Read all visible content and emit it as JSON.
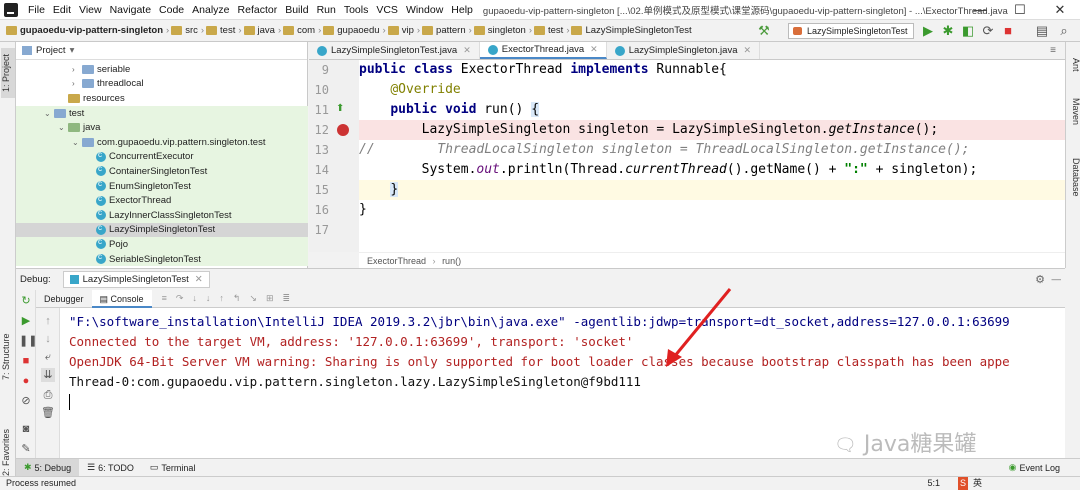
{
  "menu": [
    "File",
    "Edit",
    "View",
    "Navigate",
    "Code",
    "Analyze",
    "Refactor",
    "Build",
    "Run",
    "Tools",
    "VCS",
    "Window",
    "Help"
  ],
  "title": "gupaoedu-vip-pattern-singleton [...\\02.单例模式及原型模式\\课堂源码\\gupaoedu-vip-pattern-singleton] - ...\\ExectorThread.java",
  "breadcrumbs": [
    "gupaoedu-vip-pattern-singleton",
    "src",
    "test",
    "java",
    "com",
    "gupaoedu",
    "vip",
    "pattern",
    "singleton",
    "test",
    "LazySimpleSingletonTest"
  ],
  "run_config": "LazySimpleSingletonTest",
  "project_panel": {
    "header": "Project",
    "rows": [
      {
        "label": "seriable",
        "kind": "folder",
        "depth": 4,
        "arrow": "›"
      },
      {
        "label": "threadlocal",
        "kind": "folder",
        "depth": 4,
        "arrow": "›"
      },
      {
        "label": "resources",
        "kind": "res",
        "depth": 3,
        "arrow": ""
      },
      {
        "label": "test",
        "kind": "folder",
        "depth": 2,
        "arrow": "⌄"
      },
      {
        "label": "java",
        "kind": "src",
        "depth": 3,
        "arrow": "⌄"
      },
      {
        "label": "com.gupaoedu.vip.pattern.singleton.test",
        "kind": "folder",
        "depth": 4,
        "arrow": "⌄"
      },
      {
        "label": "ConcurrentExecutor",
        "kind": "class",
        "depth": 5,
        "arrow": ""
      },
      {
        "label": "ContainerSingletonTest",
        "kind": "class",
        "depth": 5,
        "arrow": ""
      },
      {
        "label": "EnumSingletonTest",
        "kind": "class",
        "depth": 5,
        "arrow": ""
      },
      {
        "label": "ExectorThread",
        "kind": "class",
        "depth": 5,
        "arrow": ""
      },
      {
        "label": "LazyInnerClassSingletonTest",
        "kind": "class",
        "depth": 5,
        "arrow": ""
      },
      {
        "label": "LazySimpleSingletonTest",
        "kind": "class",
        "depth": 5,
        "arrow": "",
        "selected": true
      },
      {
        "label": "Pojo",
        "kind": "class",
        "depth": 5,
        "arrow": ""
      },
      {
        "label": "SeriableSingletonTest",
        "kind": "class",
        "depth": 5,
        "arrow": ""
      }
    ]
  },
  "editor_tabs": [
    "LazySimpleSingletonTest.java",
    "ExectorThread.java",
    "LazySimpleSingleton.java"
  ],
  "active_tab": 1,
  "line_numbers": [
    "9",
    "10",
    "11",
    "12",
    "13",
    "14",
    "15",
    "16",
    "17"
  ],
  "editor_crumb": [
    "ExectorThread",
    "run()"
  ],
  "left_stripe": [
    "1: Project",
    "7: Structure",
    "2: Favorites"
  ],
  "right_stripe": [
    "Ant",
    "Maven",
    "Database"
  ],
  "debug": {
    "label": "Debug:",
    "session": "LazySimpleSingletonTest",
    "tabs": [
      "Debugger",
      "Console"
    ]
  },
  "console_lines": [
    "\"F:\\software_installation\\IntelliJ IDEA 2019.3.2\\jbr\\bin\\java.exe\" -agentlib:jdwp=transport=dt_socket,address=127.0.0.1:63699",
    "Connected to the target VM, address: '127.0.0.1:63699', transport: 'socket'",
    "OpenJDK 64-Bit Server VM warning: Sharing is only supported for boot loader classes because bootstrap classpath has been appe",
    "Thread-0:com.gupaoedu.vip.pattern.singleton.lazy.LazySimpleSingleton@f9bd111"
  ],
  "console_colors": [
    "#000080",
    "#b22222",
    "#b22222",
    "#111111"
  ],
  "bottom_tabs": [
    "5: Debug",
    "6: TODO",
    "Terminal"
  ],
  "status": "Process resumed",
  "status_right": [
    "5:1",
    "英"
  ],
  "event_log": "Event Log",
  "watermark": "Java糖果罐",
  "colors": {
    "accent": "#4a88c7",
    "arrow": "#e02020",
    "highlight_line": "#fae3e3",
    "current_line": "#fffae3"
  }
}
